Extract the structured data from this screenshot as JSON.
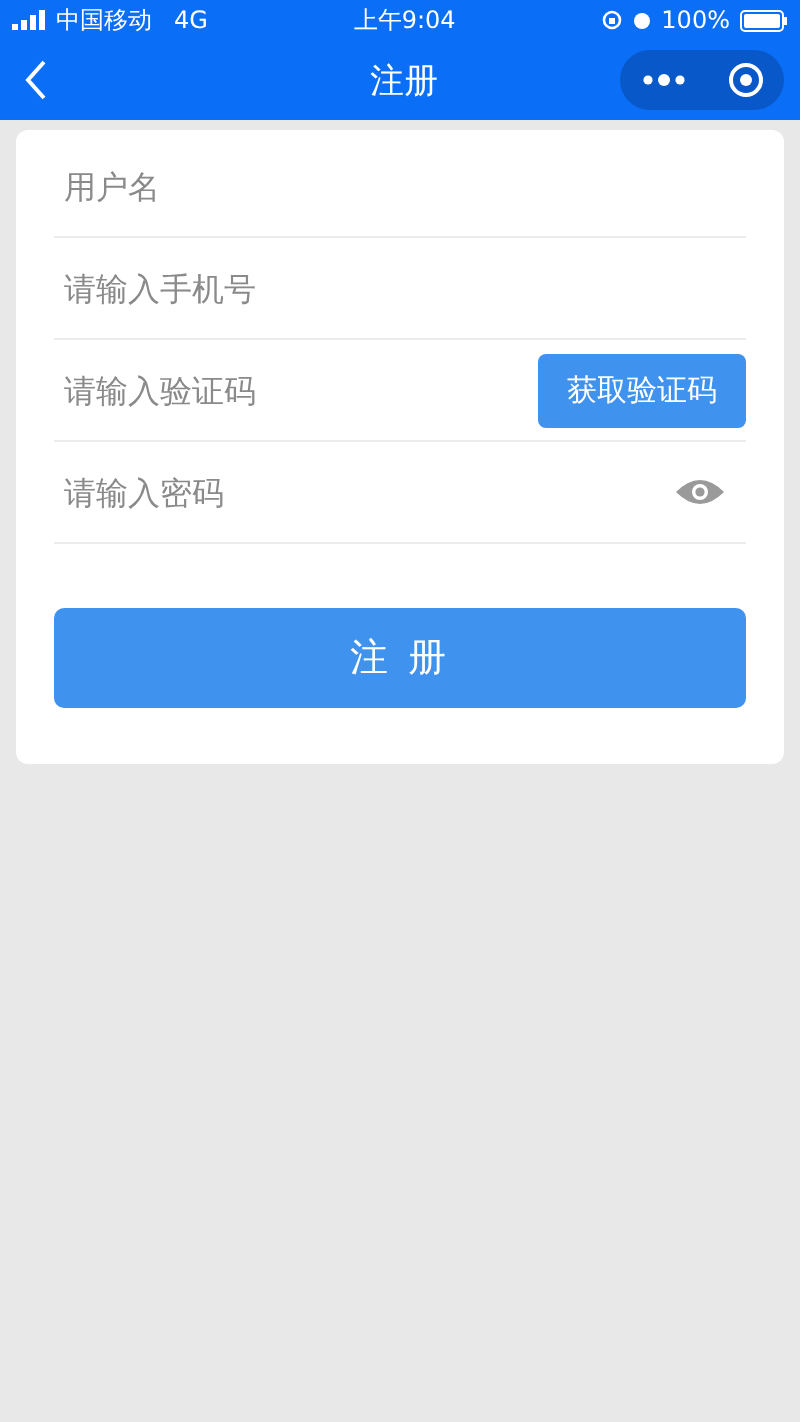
{
  "status_bar": {
    "carrier": "中国移动",
    "network": "4G",
    "time": "上午9:04",
    "battery": "100%"
  },
  "nav": {
    "title": "注册"
  },
  "fields": [
    {
      "kind": "text",
      "placeholder": "用户名"
    },
    {
      "kind": "text",
      "placeholder": "请输入手机号"
    },
    {
      "kind": "code",
      "placeholder": "请输入验证码",
      "button": "获取验证码"
    },
    {
      "kind": "password",
      "placeholder": "请输入密码"
    }
  ],
  "submit": "注 册"
}
